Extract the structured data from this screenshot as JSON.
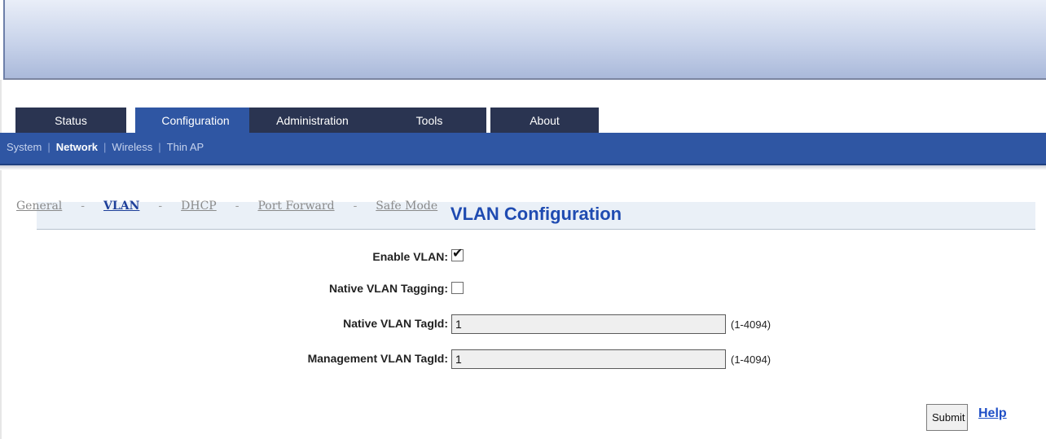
{
  "tabs": [
    {
      "label": "Status"
    },
    {
      "label": "Configuration"
    },
    {
      "label": "Administration"
    },
    {
      "label": "Tools"
    },
    {
      "label": "About"
    }
  ],
  "active_tab": "Configuration",
  "subnav": {
    "items": [
      {
        "label": "System"
      },
      {
        "label": "Network"
      },
      {
        "label": "Wireless"
      },
      {
        "label": "Thin AP"
      }
    ],
    "active": "Network"
  },
  "page_links": {
    "items": [
      {
        "label": "General"
      },
      {
        "label": "VLAN"
      },
      {
        "label": "DHCP"
      },
      {
        "label": "Port Forward"
      },
      {
        "label": "Safe Mode"
      }
    ],
    "separator": "-",
    "active": "VLAN"
  },
  "section": {
    "title": "VLAN Configuration"
  },
  "form": {
    "enable_vlan": {
      "label": "Enable VLAN:",
      "checked": true
    },
    "native_vlan_tagging": {
      "label": "Native VLAN Tagging:",
      "checked": false
    },
    "native_vlan_tagid": {
      "label": "Native VLAN TagId:",
      "value": "1",
      "range": "(1-4094)"
    },
    "management_vlan_tagid": {
      "label": "Management VLAN TagId:",
      "value": "1",
      "range": "(1-4094)"
    }
  },
  "actions": {
    "submit_label": "Submit",
    "help_label": "Help"
  },
  "colors": {
    "tab_dark": "#2a3451",
    "tab_active": "#2f56a3",
    "navbar": "#2f56a3",
    "title_blue": "#1f4bb1",
    "link_active": "#1e3f99"
  }
}
